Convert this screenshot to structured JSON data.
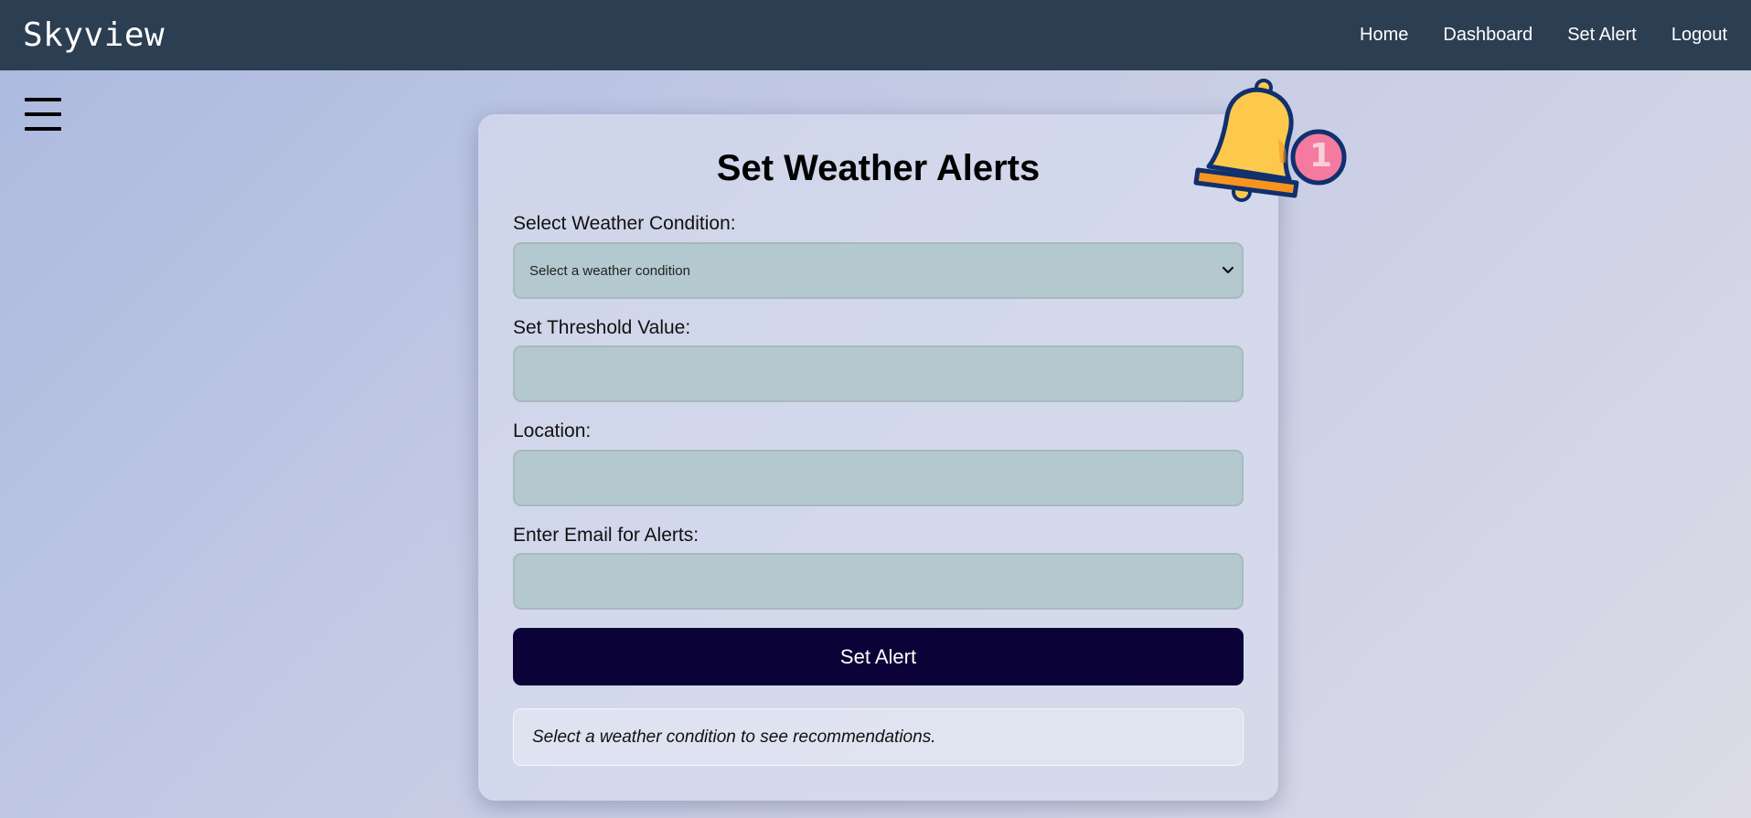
{
  "app": {
    "brand": "Skyview"
  },
  "nav": {
    "items": [
      {
        "label": "Home"
      },
      {
        "label": "Dashboard"
      },
      {
        "label": "Set Alert"
      },
      {
        "label": "Logout"
      }
    ]
  },
  "menu": {
    "icon": "hamburger-menu-icon"
  },
  "form": {
    "title": "Set Weather Alerts",
    "condition": {
      "label": "Select Weather Condition:",
      "selected": "Select a weather condition"
    },
    "threshold": {
      "label": "Set Threshold Value:",
      "value": ""
    },
    "location": {
      "label": "Location:",
      "value": ""
    },
    "email": {
      "label": "Enter Email for Alerts:",
      "value": ""
    },
    "submit_label": "Set Alert",
    "recommendation": "Select a weather condition to see recommendations."
  },
  "notification": {
    "icon": "bell-icon",
    "count": "1"
  },
  "colors": {
    "topbar": "#2c3e52",
    "button": "#0b0238",
    "field": "#b3c9cf",
    "bell": "#fdc94d",
    "badge": "#f47aa0"
  }
}
